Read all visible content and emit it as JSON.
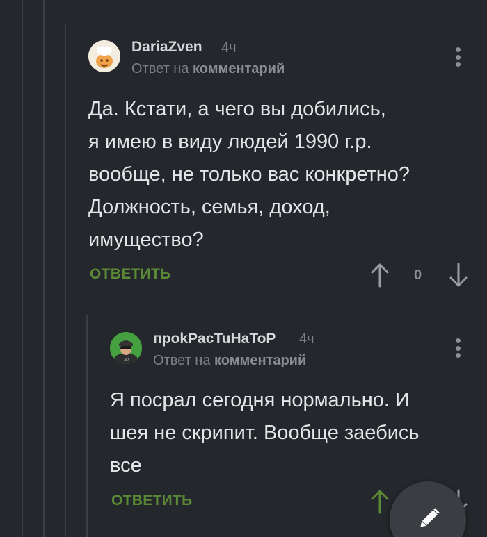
{
  "comments": [
    {
      "author": "DariaZven",
      "time": "4ч",
      "reply_prefix": "Ответ на",
      "reply_target": "комментарий",
      "lines": [
        "Да. Кстати, а чего вы добились,",
        "я имею в виду людей 1990 г.р.",
        "вообще, не только вас конкретно?",
        "Должность, семья, доход,",
        "имущество?"
      ],
      "reply_label": "ОТВЕТИТЬ",
      "score": "0"
    },
    {
      "author": "пpokPacTuHaToP",
      "time": "4ч",
      "reply_prefix": "Ответ на",
      "reply_target": "комментарий",
      "lines": [
        "Я посрал сегодня нормально. И",
        "шея не скрипит. Вообще заебись",
        "все"
      ],
      "reply_label": "ОТВЕТИТЬ"
    }
  ],
  "icons": {
    "more": "more-vertical-icon",
    "upvote": "arrow-up-icon",
    "downvote": "arrow-down-icon",
    "compose": "pencil-icon"
  },
  "colors": {
    "background": "#24272b",
    "accent_green": "#5b8a37",
    "text": "#e3e5e8",
    "muted": "#7d8187"
  }
}
